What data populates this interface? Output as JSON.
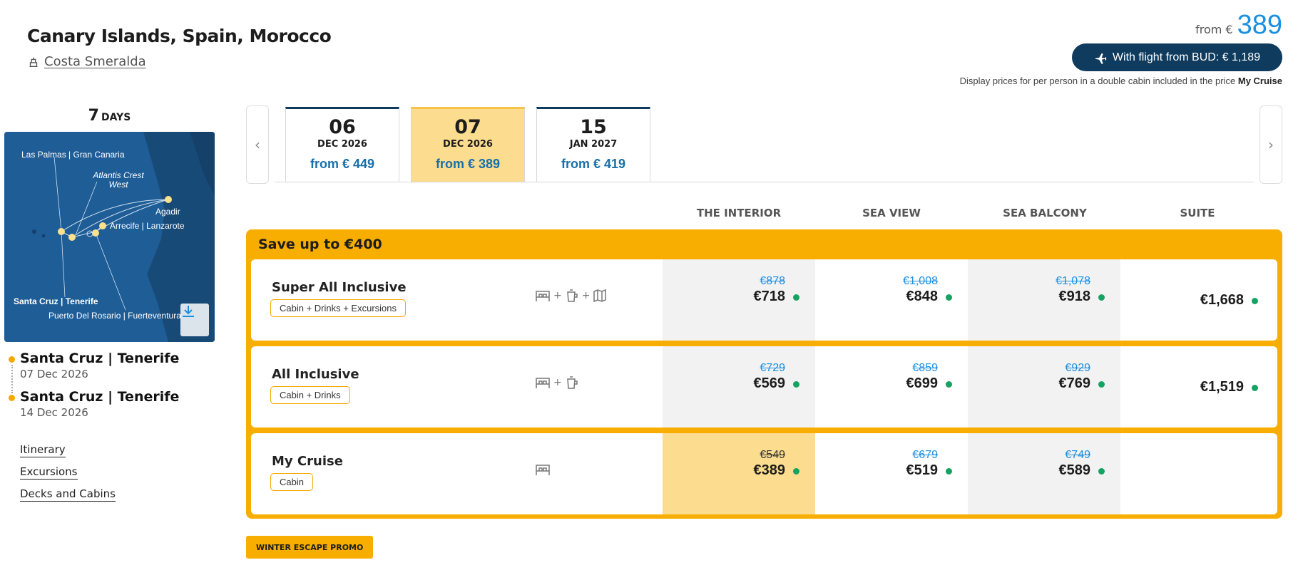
{
  "header": {
    "title": "Canary Islands, Spain, Morocco",
    "ship": "Costa Smeralda",
    "from_label": "from €",
    "from_price": "389",
    "flight_button": "With flight from BUD: € 1,189",
    "note_prefix": "Display prices for per person in a double cabin included in the price",
    "note_bold": "My Cruise"
  },
  "itinerary": {
    "days_num": "7",
    "days_unit": "DAYS",
    "map_labels": {
      "las_palmas": "Las Palmas | Gran Canaria",
      "atlantis": "Atlantis Crest West",
      "agadir": "Agadir",
      "arrecife": "Arrecife | Lanzarote",
      "santa_cruz": "Santa Cruz | Tenerife",
      "puerto": "Puerto Del Rosario | Fuerteventura"
    },
    "departure": {
      "port": "Santa Cruz | Tenerife",
      "date": "07 Dec 2026"
    },
    "arrival": {
      "port": "Santa Cruz | Tenerife",
      "date": "14 Dec 2026"
    },
    "links": [
      "Itinerary",
      "Excursions",
      "Decks and Cabins"
    ]
  },
  "dates": [
    {
      "day": "06",
      "month": "DEC 2026",
      "price": "from € 449"
    },
    {
      "day": "07",
      "month": "DEC 2026",
      "price": "from € 389",
      "active": true
    },
    {
      "day": "15",
      "month": "JAN 2027",
      "price": "from € 419"
    }
  ],
  "columns": [
    "THE INTERIOR",
    "SEA VIEW",
    "SEA BALCONY",
    "SUITE"
  ],
  "promo": {
    "title": "Save up to €400",
    "rows": [
      {
        "name": "Super All Inclusive",
        "tag": "Cabin + Drinks + Excursions",
        "icons": [
          "bed-icon",
          "drink-icon",
          "map-icon"
        ],
        "prices": [
          {
            "old": "€878",
            "new": "€718"
          },
          {
            "old": "€1,008",
            "new": "€848"
          },
          {
            "old": "€1,078",
            "new": "€918"
          },
          {
            "old": "",
            "new": "€1,668"
          }
        ]
      },
      {
        "name": "All Inclusive",
        "tag": "Cabin + Drinks",
        "icons": [
          "bed-icon",
          "drink-icon"
        ],
        "prices": [
          {
            "old": "€729",
            "new": "€569"
          },
          {
            "old": "€859",
            "new": "€699"
          },
          {
            "old": "€929",
            "new": "€769"
          },
          {
            "old": "",
            "new": "€1,519"
          }
        ]
      },
      {
        "name": "My Cruise",
        "tag": "Cabin",
        "icons": [
          "bed-icon"
        ],
        "prices": [
          {
            "old": "€549",
            "new": "€389"
          },
          {
            "old": "€679",
            "new": "€519"
          },
          {
            "old": "€749",
            "new": "€589"
          },
          {
            "old": "",
            "new": ""
          }
        ]
      }
    ]
  },
  "winter_promo": "WINTER ESCAPE PROMO",
  "colors": {
    "accent_yellow": "#f7ae00",
    "navy": "#0e3b5e",
    "price_blue": "#1b8fe0",
    "available_green": "#15a361"
  }
}
